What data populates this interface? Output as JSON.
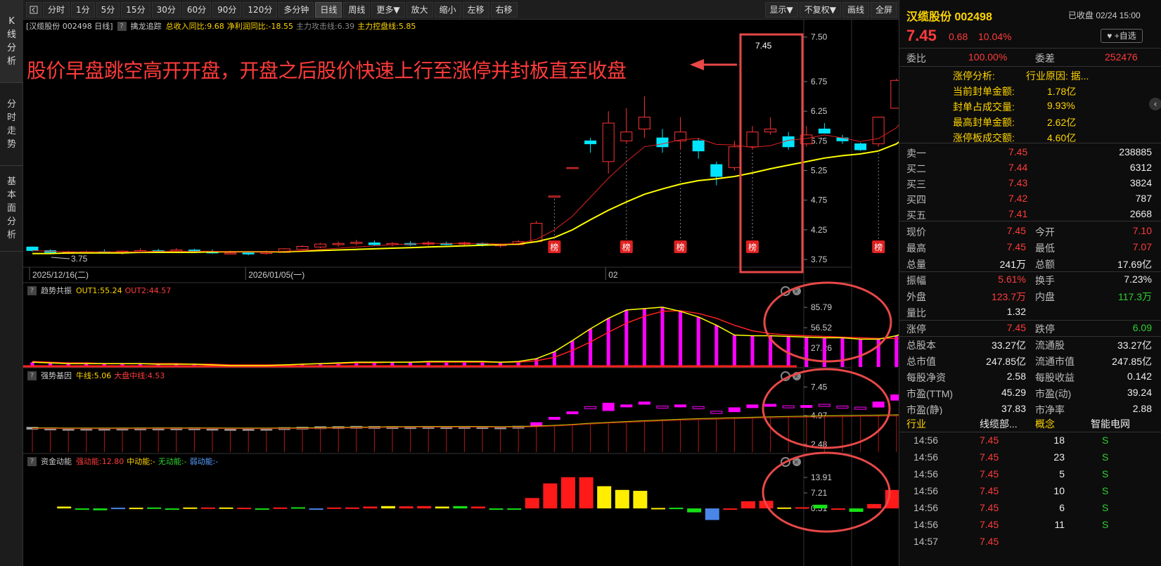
{
  "left_tabs": [
    "K线分析",
    "分时走势",
    "基本面分析"
  ],
  "toolbar": {
    "buttons": [
      "分时",
      "1分",
      "5分",
      "15分",
      "30分",
      "60分",
      "90分",
      "120分",
      "多分钟",
      "日线",
      "周线",
      "更多▼",
      "放大",
      "缩小",
      "左移",
      "右移"
    ],
    "active": "日线",
    "right_buttons": [
      "显示▼",
      "不复权▼",
      "画线",
      "全屏"
    ]
  },
  "main_header": {
    "name": "[汉缆股份 002498 日线]",
    "indicator": "擒龙追踪",
    "items": [
      "总收入同比:9.68",
      "净利润同比:-18.55",
      "主力攻击线:6.39",
      "主力控盘线:5.85"
    ]
  },
  "annotation": "股价早盘跳空高开开盘，开盘之后股价快速上行至涨停并封板直至收盘",
  "main_y_ticks": [
    "7.50",
    "6.75",
    "6.25",
    "5.75",
    "5.25",
    "4.75",
    "4.25",
    "3.75"
  ],
  "date_labels": [
    "2025/12/16(二)",
    "2026/01/05(一)",
    "02"
  ],
  "low_label": "3.75",
  "high_label": "7.45",
  "bang_label": "榜",
  "panels": [
    {
      "name": "趋势共振",
      "items": [
        "OUT1:55.24",
        "OUT2:44.57"
      ],
      "ticks": [
        "85.79",
        "56.52",
        "27.26"
      ]
    },
    {
      "name": "强势基因",
      "items": [
        "牛线:5.06",
        "大盘中线:4.53"
      ],
      "ticks": [
        "7.45",
        "4.97",
        "2.48"
      ]
    },
    {
      "name": "资金动能",
      "items": [
        "强动能:12.80",
        "中动能:-",
        "无动能:-",
        "弱动能:-"
      ],
      "ticks": [
        "13.91",
        "7.21",
        "0.51"
      ]
    }
  ],
  "colors": {
    "up": "#ff3333",
    "down": "#00e5ff",
    "ma_fast": "#e02020",
    "ma_slow": "#ffff00",
    "circle": "#e63c3c",
    "magenta": "#ff00ff"
  },
  "chart_data": {
    "type": "candlestick",
    "title": "汉缆股份 002498 日线",
    "x": [
      "2025/12/16(二)",
      "",
      "",
      "",
      "",
      "",
      "",
      "",
      "",
      "",
      "",
      "",
      "2026/01/05(一)",
      "",
      "",
      "",
      "",
      "",
      "",
      "",
      "",
      "",
      "",
      "",
      "",
      "",
      "",
      "",
      "",
      "",
      "",
      "",
      "",
      "",
      "",
      "",
      "",
      "",
      "",
      "",
      "",
      "",
      "",
      "",
      "02",
      "",
      "",
      "",
      "",
      "",
      "",
      "",
      "",
      ""
    ],
    "ohlc": [
      [
        3.96,
        3.97,
        3.88,
        3.9
      ],
      [
        3.9,
        3.92,
        3.85,
        3.87
      ],
      [
        3.86,
        3.9,
        3.84,
        3.87
      ],
      [
        3.87,
        3.9,
        3.85,
        3.88
      ],
      [
        3.88,
        3.92,
        3.86,
        3.87
      ],
      [
        3.86,
        3.9,
        3.83,
        3.89
      ],
      [
        3.88,
        3.94,
        3.86,
        3.9
      ],
      [
        3.9,
        3.93,
        3.86,
        3.89
      ],
      [
        3.89,
        3.94,
        3.87,
        3.91
      ],
      [
        3.91,
        3.93,
        3.87,
        3.88
      ],
      [
        3.88,
        3.92,
        3.85,
        3.86
      ],
      [
        3.86,
        3.9,
        3.84,
        3.86
      ],
      [
        3.86,
        3.88,
        3.82,
        3.85
      ],
      [
        3.85,
        3.9,
        3.83,
        3.87
      ],
      [
        3.87,
        3.94,
        3.86,
        3.93
      ],
      [
        3.92,
        3.99,
        3.9,
        3.97
      ],
      [
        3.96,
        4.03,
        3.94,
        4.01
      ],
      [
        4.0,
        4.05,
        3.97,
        4.02
      ],
      [
        4.02,
        4.08,
        3.99,
        4.04
      ],
      [
        4.03,
        4.07,
        3.98,
        4.0
      ],
      [
        4.0,
        4.04,
        3.97,
        4.02
      ],
      [
        4.02,
        4.06,
        3.98,
        4.0
      ],
      [
        4.01,
        4.06,
        3.98,
        4.03
      ],
      [
        4.02,
        4.05,
        3.99,
        4.01
      ],
      [
        4.01,
        4.05,
        3.97,
        4.03
      ],
      [
        4.02,
        4.04,
        3.97,
        3.99
      ],
      [
        3.98,
        4.02,
        3.95,
        4.0
      ],
      [
        4.0,
        4.08,
        3.99,
        4.05
      ],
      [
        4.05,
        4.4,
        4.03,
        4.36
      ],
      [
        4.82,
        4.82,
        4.82,
        4.82
      ],
      [
        5.3,
        5.3,
        5.3,
        5.3
      ],
      [
        5.75,
        5.8,
        5.55,
        5.7
      ],
      [
        5.4,
        6.25,
        5.2,
        6.05
      ],
      [
        5.75,
        6.3,
        5.7,
        5.9
      ],
      [
        5.95,
        6.5,
        5.8,
        6.15
      ],
      [
        5.8,
        5.95,
        5.55,
        5.65
      ],
      [
        5.75,
        6.15,
        5.6,
        5.9
      ],
      [
        5.75,
        5.8,
        5.45,
        5.58
      ],
      [
        5.35,
        5.4,
        5.0,
        5.15
      ],
      [
        5.3,
        5.75,
        5.25,
        5.65
      ],
      [
        5.65,
        6.0,
        5.6,
        5.9
      ],
      [
        5.9,
        6.15,
        5.85,
        5.95
      ],
      [
        5.82,
        5.9,
        5.6,
        5.65
      ],
      [
        5.7,
        6.0,
        5.65,
        5.85
      ],
      [
        5.95,
        6.05,
        5.88,
        5.88
      ],
      [
        5.8,
        5.85,
        5.7,
        5.75
      ],
      [
        5.7,
        5.72,
        5.58,
        5.6
      ],
      [
        5.7,
        6.15,
        5.65,
        6.15
      ],
      [
        6.3,
        6.8,
        6.3,
        6.77
      ],
      [
        7.1,
        7.45,
        7.07,
        7.45
      ]
    ],
    "ma_fast": [
      3.9,
      3.89,
      3.88,
      3.88,
      3.88,
      3.88,
      3.88,
      3.89,
      3.89,
      3.89,
      3.89,
      3.88,
      3.88,
      3.88,
      3.89,
      3.9,
      3.92,
      3.94,
      3.96,
      3.98,
      4.0,
      4.01,
      4.02,
      4.02,
      4.02,
      4.02,
      4.01,
      4.02,
      4.09,
      4.25,
      4.48,
      4.8,
      5.12,
      5.4,
      5.65,
      5.7,
      5.77,
      5.79,
      5.69,
      5.68,
      5.64,
      5.67,
      5.76,
      5.79,
      5.85,
      5.8,
      5.74,
      5.79,
      5.97,
      6.38
    ],
    "ma_slow": [
      3.85,
      3.85,
      3.86,
      3.86,
      3.86,
      3.86,
      3.87,
      3.87,
      3.87,
      3.87,
      3.88,
      3.88,
      3.88,
      3.88,
      3.88,
      3.89,
      3.9,
      3.91,
      3.92,
      3.93,
      3.94,
      3.95,
      3.96,
      3.97,
      3.98,
      3.99,
      4.0,
      4.01,
      4.05,
      4.12,
      4.25,
      4.42,
      4.58,
      4.72,
      4.85,
      4.94,
      5.02,
      5.08,
      5.11,
      5.15,
      5.21,
      5.28,
      5.34,
      5.4,
      5.46,
      5.5,
      5.53,
      5.58,
      5.7,
      5.92
    ],
    "ylim": [
      3.62,
      7.58
    ],
    "ylabel": "",
    "trend_out1": [
      7,
      6,
      5,
      5,
      5,
      5,
      5,
      4,
      4,
      4,
      3,
      2,
      2,
      2,
      3,
      4,
      5,
      6,
      7,
      7,
      7,
      7,
      8,
      8,
      8,
      8,
      7,
      8,
      12,
      22,
      38,
      55,
      70,
      82,
      84,
      86,
      80,
      72,
      60,
      46,
      45,
      45,
      44,
      43,
      42,
      42,
      40,
      40,
      45,
      55.24
    ],
    "trend_out2": [
      8,
      7,
      6,
      6,
      5,
      5,
      5,
      5,
      5,
      4,
      4,
      3,
      3,
      3,
      3,
      4,
      5,
      5,
      6,
      6,
      7,
      7,
      7,
      7,
      7,
      7,
      7,
      7,
      9,
      14,
      24,
      36,
      50,
      63,
      73,
      80,
      81,
      77,
      70,
      60,
      52,
      48,
      46,
      45,
      44,
      43,
      42,
      41,
      41,
      44.57
    ],
    "strong_bull": [
      3.9,
      3.89,
      3.88,
      3.88,
      3.88,
      3.88,
      3.88,
      3.89,
      3.89,
      3.89,
      3.89,
      3.88,
      3.88,
      3.88,
      3.89,
      3.9,
      3.92,
      3.94,
      3.96,
      3.98,
      4.0,
      4.01,
      4.02,
      4.02,
      4.02,
      4.02,
      4.01,
      4.02,
      4.06,
      4.12,
      4.2,
      4.3,
      4.38,
      4.45,
      4.52,
      4.58,
      4.64,
      4.7,
      4.74,
      4.78,
      4.82,
      4.86,
      4.89,
      4.92,
      4.95,
      4.97,
      4.99,
      5.0,
      5.03,
      5.06
    ],
    "money": [
      0.8,
      -0.6,
      -0.8,
      0.3,
      0.3,
      0.4,
      -0.4,
      0.4,
      0.4,
      0.4,
      0.3,
      -0.3,
      0.4,
      0.5,
      -0.3,
      0.4,
      0.4,
      0.8,
      1.0,
      0.9,
      1.0,
      0.8,
      1.0,
      0.8,
      -0.5,
      -0.5,
      4.5,
      10.8,
      13.5,
      13.5,
      9.6,
      8.0,
      7.6,
      0.2,
      0.3,
      -1.7,
      -5.0,
      -0.3,
      3.1,
      3.3,
      0.4,
      0.5,
      1.6,
      -0.2,
      -1.5,
      1.9,
      8.0,
      12.8
    ],
    "money_types": [
      "y",
      "g",
      "g",
      "b",
      "y",
      "g",
      "g",
      "y",
      "r",
      "y",
      "r",
      "g",
      "r",
      "g",
      "b",
      "r",
      "r",
      "r",
      "y",
      "r",
      "r",
      "y",
      "g",
      "r",
      "g",
      "g",
      "r",
      "r",
      "r",
      "r",
      "y",
      "y",
      "y",
      "y",
      "g",
      "g",
      "b",
      "r",
      "r",
      "r",
      "y",
      "r",
      "g",
      "r",
      "g",
      "r",
      "r",
      "r"
    ]
  },
  "quote": {
    "name": "汉缆股份 002498",
    "status": "已收盘 02/24 15:00",
    "price": "7.45",
    "change": "0.68",
    "pct": "10.04%",
    "watch": "♥ +自选"
  },
  "weibi": {
    "l1": "委比",
    "v1": "100.00%",
    "l2": "委差",
    "v2": "252476"
  },
  "limit_analysis": [
    {
      "k": "涨停分析:",
      "v": "行业原因: 据..."
    },
    {
      "k": "当前封单金额:",
      "v": "1.78亿"
    },
    {
      "k": "封单占成交量:",
      "v": "9.93%"
    },
    {
      "k": "最高封单金额:",
      "v": "2.62亿"
    },
    {
      "k": "涨停板成交额:",
      "v": "4.60亿"
    }
  ],
  "orders": [
    {
      "l": "卖一",
      "p": "7.45",
      "v": "238885"
    },
    {
      "l": "买二",
      "p": "7.44",
      "v": "6312"
    },
    {
      "l": "买三",
      "p": "7.43",
      "v": "3824"
    },
    {
      "l": "买四",
      "p": "7.42",
      "v": "787"
    },
    {
      "l": "买五",
      "p": "7.41",
      "v": "2668"
    }
  ],
  "stats": [
    {
      "l1": "现价",
      "v1": "7.45",
      "c1": "red",
      "l2": "今开",
      "v2": "7.10",
      "c2": "red"
    },
    {
      "l1": "最高",
      "v1": "7.45",
      "c1": "red",
      "l2": "最低",
      "v2": "7.07",
      "c2": "red"
    },
    {
      "l1": "总量",
      "v1": "241万",
      "c1": "wht",
      "l2": "总额",
      "v2": "17.69亿",
      "c2": "wht"
    },
    {
      "l1": "振幅",
      "v1": "5.61%",
      "c1": "red",
      "l2": "换手",
      "v2": "7.23%",
      "c2": "wht"
    },
    {
      "l1": "外盘",
      "v1": "123.7万",
      "c1": "red",
      "l2": "内盘",
      "v2": "117.3万",
      "c2": "green"
    },
    {
      "l1": "量比",
      "v1": "1.32",
      "c1": "wht",
      "l2": "",
      "v2": "",
      "c2": "wht"
    },
    {
      "l1": "涨停",
      "v1": "7.45",
      "c1": "red",
      "l2": "跌停",
      "v2": "6.09",
      "c2": "green"
    },
    {
      "l1": "总股本",
      "v1": "33.27亿",
      "c1": "wht",
      "l2": "流通股",
      "v2": "33.27亿",
      "c2": "wht"
    },
    {
      "l1": "总市值",
      "v1": "247.85亿",
      "c1": "wht",
      "l2": "流通市值",
      "v2": "247.85亿",
      "c2": "wht"
    },
    {
      "l1": "每股净资",
      "v1": "2.58",
      "c1": "wht",
      "l2": "每股收益",
      "v2": "0.142",
      "c2": "wht"
    },
    {
      "l1": "市盈(TTM)",
      "v1": "45.29",
      "c1": "wht",
      "l2": "市盈(动)",
      "v2": "39.24",
      "c2": "wht"
    },
    {
      "l1": "市盈(静)",
      "v1": "37.83",
      "c1": "wht",
      "l2": "市净率",
      "v2": "2.88",
      "c2": "wht"
    }
  ],
  "industry": {
    "l1": "行业",
    "v1": "线缆部...",
    "l2": "概念",
    "v2": "智能电网"
  },
  "ticks": [
    {
      "t": "14:56",
      "p": "7.45",
      "v": "18",
      "d": "S"
    },
    {
      "t": "14:56",
      "p": "7.45",
      "v": "23",
      "d": "S"
    },
    {
      "t": "14:56",
      "p": "7.45",
      "v": "5",
      "d": "S"
    },
    {
      "t": "14:56",
      "p": "7.45",
      "v": "10",
      "d": "S"
    },
    {
      "t": "14:56",
      "p": "7.45",
      "v": "6",
      "d": "S"
    },
    {
      "t": "14:56",
      "p": "7.45",
      "v": "11",
      "d": "S"
    },
    {
      "t": "14:57",
      "p": "7.45",
      "v": "",
      "d": ""
    }
  ]
}
